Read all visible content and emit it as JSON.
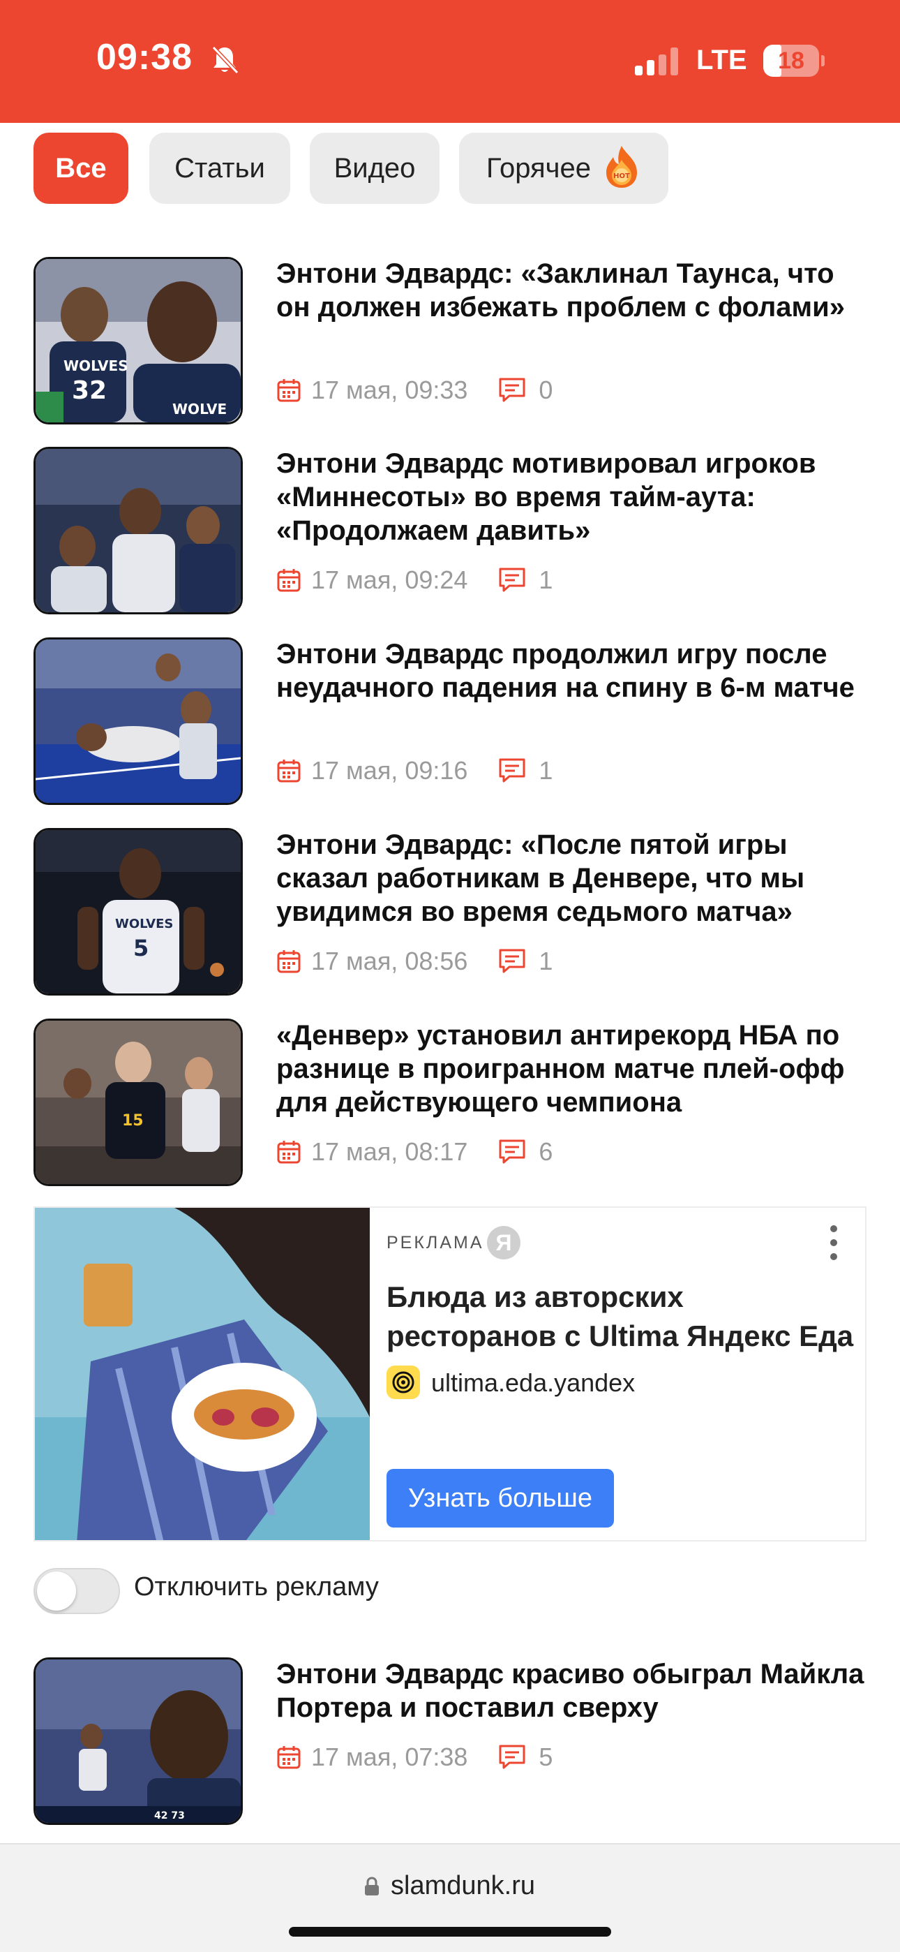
{
  "status": {
    "time": "09:38",
    "network": "LTE",
    "battery": "18"
  },
  "tabs": [
    {
      "label": "Все"
    },
    {
      "label": "Статьи"
    },
    {
      "label": "Видео"
    },
    {
      "label": "Горячее"
    }
  ],
  "articles": [
    {
      "title": "Энтони Эдвардс: «Заклинал Таунса, что он должен избежать проблем с фолами»",
      "date": "17 мая, 09:33",
      "comments": "0"
    },
    {
      "title": "Энтони Эдвардс мотивировал игроков «Миннесоты» во время тайм-аута: «Продолжаем давить»",
      "date": "17 мая, 09:24",
      "comments": "1"
    },
    {
      "title": "Энтони Эдвардс продолжил игру после неудачного падения на спину в 6-м матче",
      "date": "17 мая, 09:16",
      "comments": "1"
    },
    {
      "title": "Энтони Эдвардс: «После пятой игры сказал работникам в Денвере, что мы увидимся во время седьмого матча»",
      "date": "17 мая, 08:56",
      "comments": "1"
    },
    {
      "title": "«Денвер» установил антирекорд НБА по разнице в проигранном матче плей-офф для действующего чемпиона",
      "date": "17 мая, 08:17",
      "comments": "6"
    },
    {
      "title": "Энтони Эдвардс красиво обыграл Майкла Портера и поставил сверху",
      "date": "17 мая, 07:38",
      "comments": "5"
    }
  ],
  "ad": {
    "label": "РЕКЛАМА",
    "logo": "Я",
    "title": "Блюда из авторских ресторанов с Ultima Яндекс Еда",
    "domain": "ultima.eda.yandex",
    "button": "Узнать больше"
  },
  "ad_toggle": {
    "label": "Отключить рекламу",
    "on": false
  },
  "browser": {
    "url": "slamdunk.ru"
  },
  "colors": {
    "brand": "#ec4630",
    "ad_button": "#3d7ff6",
    "meta_gray": "#9a9a9a"
  }
}
